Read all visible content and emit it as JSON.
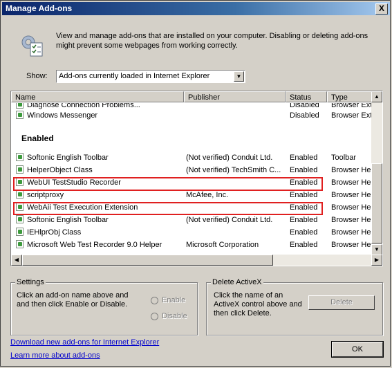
{
  "window": {
    "title": "Manage Add-ons",
    "close_label": "X"
  },
  "intro": {
    "text": "View and manage add-ons that are installed on your computer. Disabling or deleting add-ons might prevent some webpages from working correctly."
  },
  "show": {
    "label": "Show:",
    "value": "Add-ons currently loaded in Internet Explorer"
  },
  "columns": [
    "Name",
    "Publisher",
    "Status",
    "Type"
  ],
  "group_label": "Enabled",
  "rows_top": [
    {
      "name": "Diagnose Connection Problems...",
      "publisher": "",
      "status": "Disabled",
      "type": "Browser Ext"
    },
    {
      "name": "Windows Messenger",
      "publisher": "",
      "status": "Disabled",
      "type": "Browser Ext"
    }
  ],
  "rows": [
    {
      "name": "Softonic English Toolbar",
      "publisher": "(Not verified) Conduit Ltd.",
      "status": "Enabled",
      "type": "Toolbar"
    },
    {
      "name": "HelperObject Class",
      "publisher": "(Not verified) TechSmith C...",
      "status": "Enabled",
      "type": "Browser Hel"
    },
    {
      "name": "WebUI TestStudio Recorder",
      "publisher": "",
      "status": "Enabled",
      "type": "Browser Hel"
    },
    {
      "name": "scriptproxy",
      "publisher": "McAfee, Inc.",
      "status": "Enabled",
      "type": "Browser Hel"
    },
    {
      "name": "WebAii Test Execution Extension",
      "publisher": "",
      "status": "Enabled",
      "type": "Browser Hel"
    },
    {
      "name": "Softonic English Toolbar",
      "publisher": "(Not verified) Conduit Ltd.",
      "status": "Enabled",
      "type": "Browser Hel"
    },
    {
      "name": "IEHlprObj Class",
      "publisher": "",
      "status": "Enabled",
      "type": "Browser Hel"
    },
    {
      "name": "Microsoft Web Test Recorder 9.0 Helper",
      "publisher": "Microsoft Corporation",
      "status": "Enabled",
      "type": "Browser Hel"
    }
  ],
  "settings": {
    "legend": "Settings",
    "text": "Click an add-on name above and and then click Enable or Disable.",
    "enable_label": "Enable",
    "disable_label": "Disable"
  },
  "delete_activex": {
    "legend": "Delete ActiveX",
    "text": "Click the name of an ActiveX control above and then click Delete.",
    "delete_label": "Delete"
  },
  "links": {
    "download": "Download new add-ons for Internet Explorer",
    "learn": "Learn more about add-ons"
  },
  "ok_label": "OK",
  "icons": {
    "intro": "gear-checklist-icon",
    "row": "addon-icon"
  },
  "colors": {
    "title_bar": "#0a246a",
    "highlight": "#e02020",
    "link": "#0000cc"
  }
}
